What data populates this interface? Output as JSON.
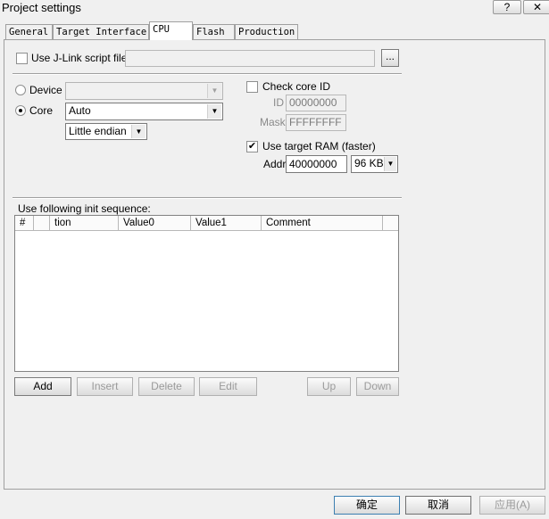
{
  "window": {
    "title": "Project settings",
    "help_label": "?",
    "close_label": "✕"
  },
  "tabs": [
    {
      "label": "General"
    },
    {
      "label": "Target Interface"
    },
    {
      "label": "CPU"
    },
    {
      "label": "Flash"
    },
    {
      "label": "Production"
    }
  ],
  "active_tab": "CPU",
  "jlink": {
    "label": "Use J-Link script file",
    "checked": false,
    "value": "",
    "browse_label": "..."
  },
  "device": {
    "label": "Device",
    "value": "",
    "selected": false
  },
  "core": {
    "label": "Core",
    "value": "Auto",
    "selected": true,
    "endian_value": "Little endian"
  },
  "check_core_id": {
    "label": "Check core ID",
    "checked": false,
    "id_label": "ID",
    "id_value": "00000000",
    "mask_label": "Mask",
    "mask_value": "FFFFFFFF"
  },
  "target_ram": {
    "label": "Use target RAM (faster)",
    "checked": true,
    "addr_label": "Addr",
    "addr_value": "40000000",
    "size_value": "96 KB"
  },
  "init_sequence": {
    "label": "Use following init sequence:",
    "columns": [
      "#",
      "tion",
      "Value0",
      "Value1",
      "Comment"
    ],
    "rows": []
  },
  "seq_buttons": {
    "add": "Add",
    "insert": "Insert",
    "delete": "Delete",
    "edit": "Edit",
    "up": "Up",
    "down": "Down"
  },
  "dialog_buttons": {
    "ok": "确定",
    "cancel": "取消",
    "apply": "应用(A)"
  }
}
